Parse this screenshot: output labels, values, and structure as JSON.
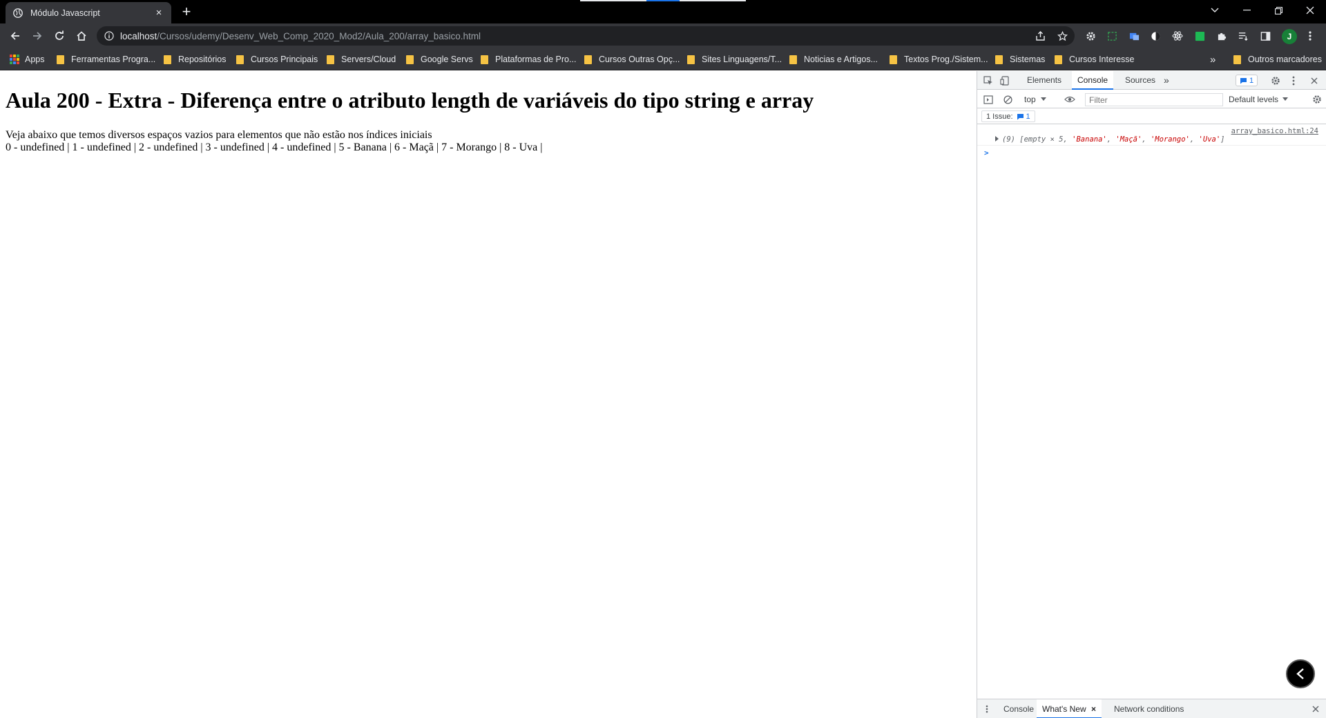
{
  "browser": {
    "tab": {
      "title": "Módulo Javascript",
      "close_label": "×"
    },
    "new_tab_label": "+",
    "url_host": "localhost",
    "url_path": "/Cursos/udemy/Desenv_Web_Comp_2020_Mod2/Aula_200/array_basico.html",
    "profile_initial": "J",
    "bookmarks": [
      "Apps",
      "Ferramentas Progra...",
      "Repositórios",
      "Cursos Principais",
      "Servers/Cloud",
      "Google Servs",
      "Plataformas de Pro...",
      "Cursos Outras Opç...",
      "Sites Linguagens/T...",
      "Noticias e Artigos...",
      "Textos Prog./Sistem...",
      "Sistemas",
      "Cursos Interesse"
    ],
    "bookmarks_overflow": "»",
    "other_bookmarks": "Outros marcadores"
  },
  "page": {
    "heading": "Aula 200 - Extra - Diferença entre o atributo length de variáveis do tipo string e array",
    "intro": "Veja abaixo que temos diversos espaços vazios para elementos que não estão nos índices iniciais",
    "items_line": "0 - undefined | 1 - undefined | 2 - undefined | 3 - undefined | 4 - undefined | 5 - Banana | 6 - Maçã | 7 - Morango | 8 - Uva |"
  },
  "devtools": {
    "tabs": [
      "Elements",
      "Console",
      "Sources"
    ],
    "active_tab": "Console",
    "more_tabs": "»",
    "issues_count": "1",
    "context": "top",
    "filter_placeholder": "Filter",
    "levels": "Default levels",
    "issues_label": "1 Issue:",
    "issues_chip_count": "1",
    "log_source": "array_basico.html:24",
    "log_prefix": "(9) [empty × 5, ",
    "log_strings": [
      "'Banana'",
      "'Maçã'",
      "'Morango'",
      "'Uva'"
    ],
    "log_suffix": "]",
    "prompt": ">",
    "drawer_tabs": [
      "Console",
      "What's New",
      "Network conditions"
    ],
    "drawer_close": "×"
  },
  "colors": {
    "accent": "#1a73e8",
    "folder": "#f6c344",
    "console_string": "#c80000",
    "avatar": "#188038"
  }
}
